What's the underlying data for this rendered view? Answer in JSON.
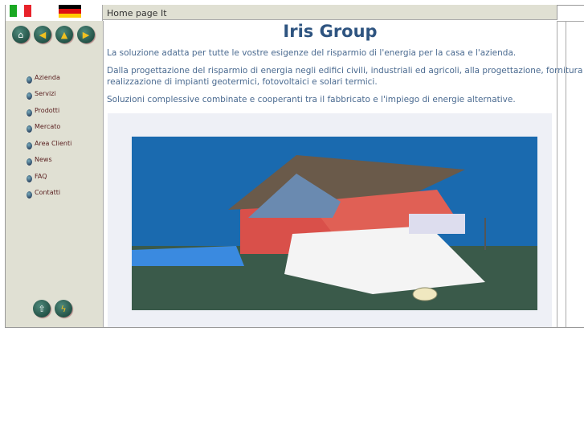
{
  "header": {
    "title": "Home page It"
  },
  "flags": [
    {
      "name": "italian-flag",
      "colors": [
        "#1aa822",
        "#ffffff",
        "#e8222a"
      ]
    },
    {
      "name": "german-flag",
      "colors": [
        "#000000",
        "#dd1111",
        "#ffcc00"
      ]
    }
  ],
  "toolbar": [
    {
      "name": "home-button",
      "icon": "home-icon"
    },
    {
      "name": "back-button",
      "icon": "arrow-left-icon"
    },
    {
      "name": "up-button",
      "icon": "arrow-up-icon"
    },
    {
      "name": "forward-button",
      "icon": "arrow-right-icon"
    }
  ],
  "nav": {
    "items": [
      {
        "label": "Azienda"
      },
      {
        "label": "Servizi"
      },
      {
        "label": "Prodotti"
      },
      {
        "label": "Mercato"
      },
      {
        "label": "Area Clienti"
      },
      {
        "label": "News"
      },
      {
        "label": "FAQ"
      },
      {
        "label": "Contatti"
      }
    ]
  },
  "bottom_buttons": [
    {
      "name": "top-button",
      "icon": "page-up-icon"
    },
    {
      "name": "flash-button",
      "icon": "flash-icon"
    }
  ],
  "main": {
    "title": "Iris Group",
    "p1": "La soluzione adatta per tutte le vostre esigenze del risparmio di l'energia per la casa e l'azienda.",
    "p2a": "Dalla progettazione  del risparmio  di energia negli edifici civili, industriali ed  agricoli, alla progettazione, fornitura e",
    "p2b": "realizzazione di impianti geotermici, fotovoltaici e solari termici.",
    "p3": "Soluzioni complessive combinate e cooperanti tra il fabbricato e l'impiego di energie alternative."
  }
}
